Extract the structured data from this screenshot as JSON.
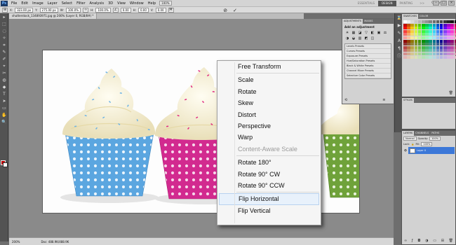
{
  "menubar": {
    "logo": "Ps",
    "items": [
      "File",
      "Edit",
      "Image",
      "Layer",
      "Select",
      "Filter",
      "Analysis",
      "3D",
      "View",
      "Window",
      "Help"
    ],
    "zoom": "100%",
    "workspaces": [
      "ESSENTIALS",
      "DESIGN",
      "PAINTING",
      ">>"
    ],
    "active_workspace": "DESIGN",
    "minibridge": "CS Live"
  },
  "options": {
    "x_label": "X:",
    "x_value": "323.00 px",
    "y_label": "Y:",
    "y_value": "275.00 px",
    "w_label": "W:",
    "w_value": "100.0%",
    "h_label": "H:",
    "h_value": "100.0%",
    "angle_value": "0.00",
    "h_skew": "0.00",
    "v_skew": "0.00",
    "cancel_icon": "⊘",
    "commit_icon": "✓"
  },
  "document": {
    "tab_title": "shutterstock_134893971.jpg @ 200% (Layer 0, RGB/8#) *",
    "zoom": "200%",
    "doc_info": "Doc: 488.9K/488.9K"
  },
  "tools": [
    "▸",
    "⬚",
    "◌",
    "✧",
    "⌗",
    "✎",
    "✐",
    "⌖",
    "✂",
    "◍",
    "◆",
    "T",
    "➤",
    "▭",
    "✋",
    "🔍"
  ],
  "context_menu": {
    "items": [
      {
        "label": "Free Transform",
        "state": "normal"
      },
      {
        "sep": true
      },
      {
        "label": "Scale",
        "state": "normal"
      },
      {
        "label": "Rotate",
        "state": "normal"
      },
      {
        "label": "Skew",
        "state": "normal"
      },
      {
        "label": "Distort",
        "state": "normal"
      },
      {
        "label": "Perspective",
        "state": "normal"
      },
      {
        "label": "Warp",
        "state": "normal"
      },
      {
        "label": "Content-Aware Scale",
        "state": "disabled"
      },
      {
        "sep": true
      },
      {
        "label": "Rotate 180°",
        "state": "normal"
      },
      {
        "label": "Rotate 90° CW",
        "state": "normal"
      },
      {
        "label": "Rotate 90° CCW",
        "state": "normal"
      },
      {
        "sep": true
      },
      {
        "label": "Flip Horizontal",
        "state": "highlighted"
      },
      {
        "label": "Flip Vertical",
        "state": "normal"
      }
    ]
  },
  "adjustments": {
    "tabs": [
      "ADJUSTMENTS",
      "MASKS"
    ],
    "title": "Add an adjustment",
    "icons": [
      "☀",
      "▦",
      "◪",
      "▽",
      "◧",
      "▣",
      "⚖",
      "◑",
      "◒",
      "▥",
      "◩",
      "◫"
    ],
    "presets": [
      "Levels Presets",
      "Curves Presets",
      "Exposure Presets",
      "Hue/Saturation Presets",
      "Black & White Presets",
      "Channel Mixer Presets",
      "Selective Color Presets"
    ]
  },
  "swatches": {
    "tabs": [
      "SWATCHES",
      "COLOR"
    ]
  },
  "styles": {
    "tabs": [
      "STYLES"
    ]
  },
  "layers": {
    "tabs": [
      "LAYERS",
      "CHANNELS",
      "PATHS"
    ],
    "blend_mode": "Normal",
    "opacity_label": "Opacity:",
    "opacity": "100%",
    "lock_label": "Lock:",
    "fill_label": "Fill:",
    "fill": "100%",
    "layer_name": "Layer 0"
  },
  "colors": {
    "fg": "#c00000",
    "bg": "#ffffff",
    "highlight": "#e8f1fb",
    "selected_layer": "#3c78d8"
  }
}
